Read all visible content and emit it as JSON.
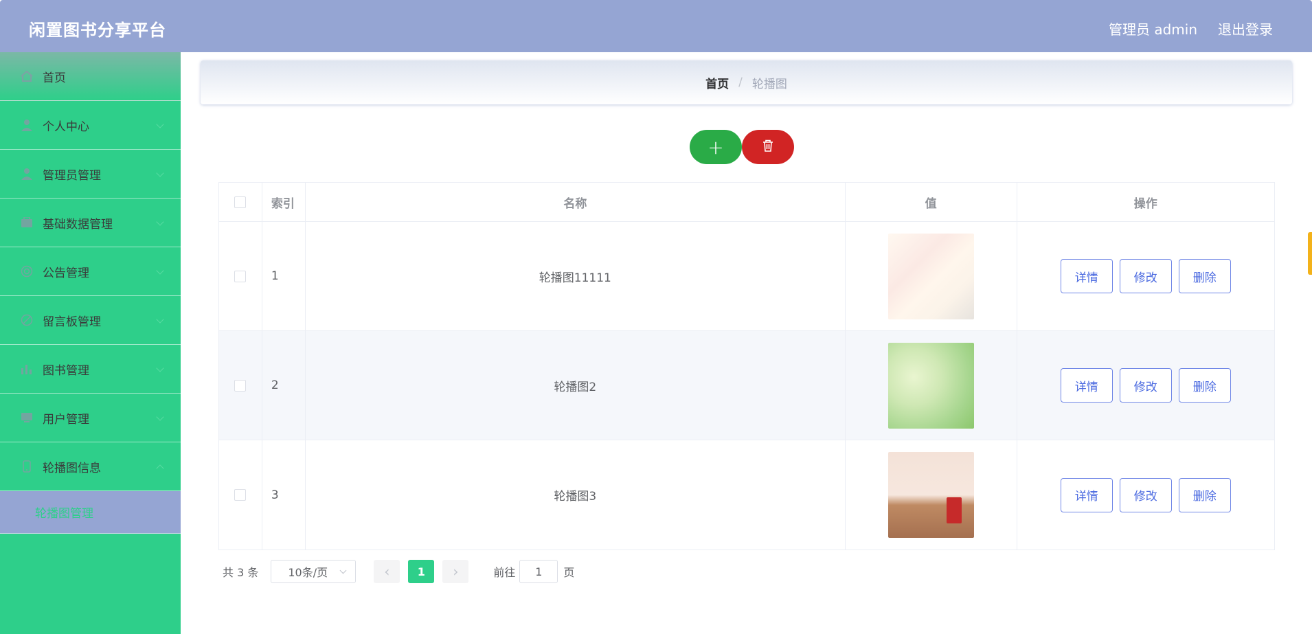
{
  "header": {
    "brand": "闲置图书分享平台",
    "user": "管理员 admin",
    "logout": "退出登录"
  },
  "sidebar": {
    "items": [
      {
        "label": "首页",
        "icon": "home-icon"
      },
      {
        "label": "个人中心",
        "icon": "user-icon"
      },
      {
        "label": "管理员管理",
        "icon": "admin-icon"
      },
      {
        "label": "基础数据管理",
        "icon": "database-icon"
      },
      {
        "label": "公告管理",
        "icon": "notice-icon"
      },
      {
        "label": "留言板管理",
        "icon": "message-icon"
      },
      {
        "label": "图书管理",
        "icon": "chart-icon"
      },
      {
        "label": "用户管理",
        "icon": "users-icon"
      },
      {
        "label": "轮播图信息",
        "icon": "phone-icon"
      }
    ],
    "submenu": {
      "label": "轮播图管理"
    }
  },
  "breadcrumb": {
    "home": "首页",
    "separator": "/",
    "current": "轮播图"
  },
  "toolbar": {
    "add_label": "+"
  },
  "table": {
    "headers": {
      "index": "索引",
      "name": "名称",
      "value": "值",
      "ops": "操作"
    },
    "rows": [
      {
        "index": "1",
        "name": "轮播图11111"
      },
      {
        "index": "2",
        "name": "轮播图2"
      },
      {
        "index": "3",
        "name": "轮播图3"
      }
    ],
    "ops": {
      "detail": "详情",
      "edit": "修改",
      "delete": "删除"
    }
  },
  "pagination": {
    "total": "共 3 条",
    "page_size": "10条/页",
    "prev": "‹",
    "current_page": "1",
    "next": "›",
    "goto_label": "前往",
    "goto_value": "1",
    "page_unit": "页"
  },
  "colors": {
    "header": "#95a5d3",
    "sidebar": "#2ecf8a",
    "add_button": "#2aab47",
    "delete_button": "#d12424",
    "op_button_border": "#6f86e6"
  }
}
